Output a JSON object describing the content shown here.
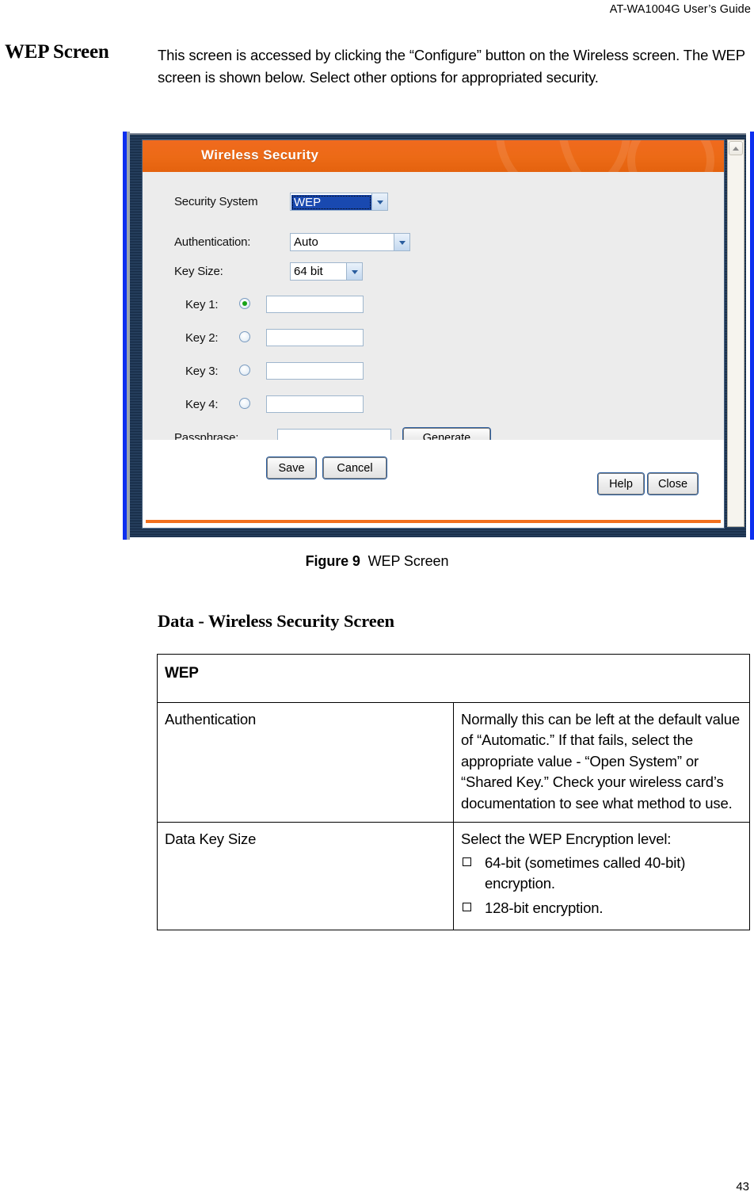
{
  "header": {
    "running_head": "AT-WA1004G User’s Guide"
  },
  "section": {
    "title": "WEP Screen",
    "intro": "This screen is accessed by clicking the “Configure” button on the Wireless screen. The WEP screen is shown below. Select other options for appropriated security."
  },
  "figure": {
    "number": "Figure 9",
    "caption": "WEP Screen"
  },
  "dialog": {
    "title": "Wireless Security",
    "colors": {
      "orange": "#ec6a16",
      "panel": "#ececec",
      "page_edge_blue": "#0d2ff0",
      "radio_selected": "#17a317",
      "select_highlight": "#1949b0"
    },
    "fields": {
      "security_system": {
        "label": "Security System",
        "value": "WEP"
      },
      "authentication": {
        "label": "Authentication:",
        "value": "Auto"
      },
      "key_size": {
        "label": "Key Size:",
        "value": "64 bit"
      },
      "passphrase": {
        "label": "Passphrase:",
        "value": ""
      }
    },
    "keys": [
      {
        "label": "Key 1:",
        "selected": true,
        "value": ""
      },
      {
        "label": "Key 2:",
        "selected": false,
        "value": ""
      },
      {
        "label": "Key 3:",
        "selected": false,
        "value": ""
      },
      {
        "label": "Key 4:",
        "selected": false,
        "value": ""
      }
    ],
    "buttons": {
      "generate": "Generate",
      "save": "Save",
      "cancel": "Cancel",
      "help": "Help",
      "close": "Close"
    },
    "scrollbar": {
      "up_arrow": "scroll-up-arrow"
    }
  },
  "data_section": {
    "heading": "Data - Wireless Security Screen",
    "table": {
      "group_header": "WEP",
      "rows": [
        {
          "name": "Authentication",
          "description": "Normally this can be left at the default value of “Automatic.” If that fails, select the appropriate value - “Open System” or “Shared Key.” Check your wireless card’s documentation to see what method to use.",
          "bullets": []
        },
        {
          "name": "Data Key Size",
          "description": "Select the WEP Encryption level:",
          "bullets": [
            "64-bit (sometimes called 40-bit) encryption.",
            "128-bit encryption."
          ]
        }
      ]
    }
  },
  "footer": {
    "page_number": "43"
  }
}
